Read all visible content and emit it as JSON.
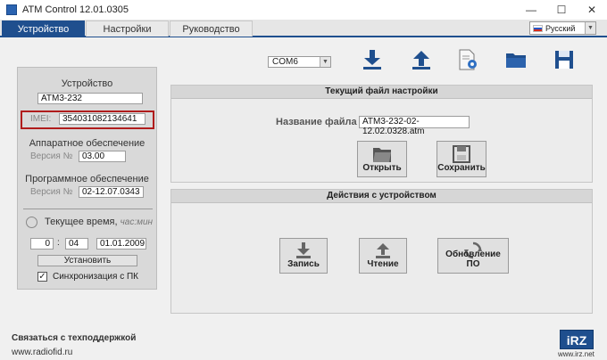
{
  "window": {
    "title": "ATM Control 12.01.0305",
    "minimize": "—",
    "maximize": "☐",
    "close": "✕"
  },
  "tabs": [
    {
      "label": "Устройство",
      "active": true
    },
    {
      "label": "Настройки",
      "active": false
    },
    {
      "label": "Руководство",
      "active": false
    }
  ],
  "language": {
    "selected": "Русский"
  },
  "device_panel": {
    "title": "Устройство",
    "model": "ATM3-232",
    "imei_label": "IMEI:",
    "imei_value": "354031082134641",
    "hardware_title": "Аппаратное обеспечение",
    "hardware_version_label": "Версия №",
    "hardware_version": "03.00",
    "software_title": "Программное обеспечение",
    "software_version_label": "Версия №",
    "software_version": "02-12.07.0343",
    "time_title": "Текущее время,",
    "time_hint": "час:мин",
    "hour": "0",
    "minute": "04",
    "date": "01.01.2009",
    "set_button": "Установить",
    "sync_label": "Синхронизация с ПК",
    "sync_checked": true
  },
  "toolbar": {
    "port": "COM6",
    "icons": [
      "download-icon",
      "upload-icon",
      "settings-doc-icon",
      "folder-icon",
      "save-icon"
    ]
  },
  "config_section": {
    "title": "Текущий файл настройки",
    "filename_label": "Название файла",
    "filename": "ATM3-232-02-12.02.0328.atm",
    "open_button": "Открыть",
    "save_button": "Сохранить"
  },
  "actions_section": {
    "title": "Действия с устройством",
    "write_button": "Запись",
    "read_button": "Чтение",
    "update_button": "Обновление ПО"
  },
  "footer": {
    "support": "Связаться с техподдержкой",
    "website": "www.radiofid.ru",
    "logo": "iRZ",
    "logo_url": "www.irz.net"
  },
  "colors": {
    "accent": "#1f4f8e",
    "highlight": "#b01c1c"
  }
}
